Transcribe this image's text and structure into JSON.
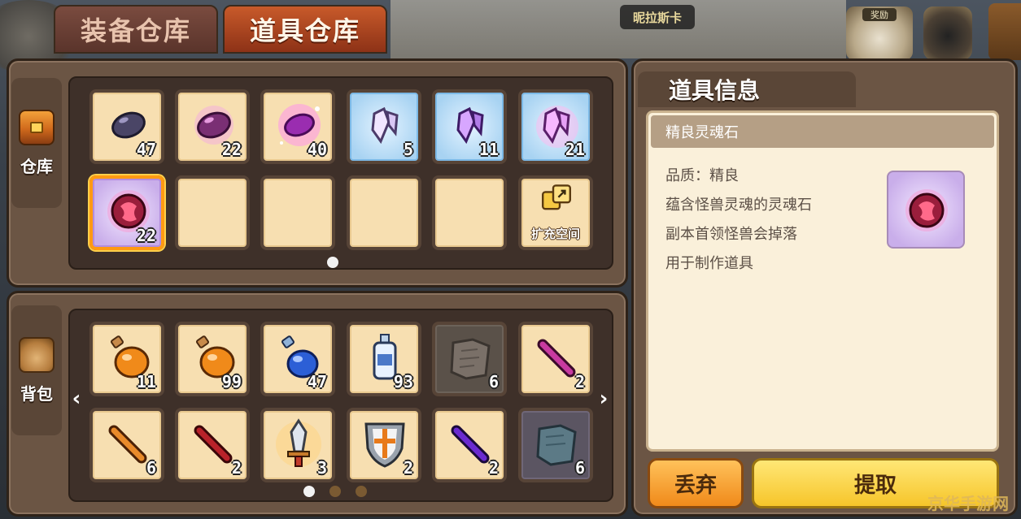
{
  "top": {
    "map_name": "昵拉斯卡",
    "icon1_tag": "奖励"
  },
  "tabs": [
    {
      "label": "装备仓库"
    },
    {
      "label": "道具仓库"
    }
  ],
  "storage": {
    "label": "仓库",
    "slots": [
      {
        "icon": "dark-stone-icon",
        "count": "47"
      },
      {
        "icon": "purple-stone-icon",
        "count": "22"
      },
      {
        "icon": "glowing-stone-icon",
        "count": "40"
      },
      {
        "icon": "crystal-icon",
        "count": "5"
      },
      {
        "icon": "purple-crystal-icon",
        "count": "11"
      },
      {
        "icon": "pink-crystal-icon",
        "count": "21"
      },
      {
        "icon": "soul-stone-icon",
        "count": "22"
      },
      {
        "icon": "empty",
        "count": ""
      },
      {
        "icon": "empty",
        "count": ""
      },
      {
        "icon": "empty",
        "count": ""
      },
      {
        "icon": "empty",
        "count": ""
      },
      {
        "icon": "expand-icon",
        "label": "扩充空间"
      }
    ]
  },
  "bag": {
    "label": "背包",
    "slots": [
      {
        "icon": "orange-potion-icon",
        "count": "11"
      },
      {
        "icon": "orange-potion-icon",
        "count": "99"
      },
      {
        "icon": "blue-potion-icon",
        "count": "47"
      },
      {
        "icon": "water-bottle-icon",
        "count": "93"
      },
      {
        "icon": "map-scroll-icon",
        "count": "6"
      },
      {
        "icon": "pink-vial-icon",
        "count": "2"
      },
      {
        "icon": "orange-vial-icon",
        "count": "6"
      },
      {
        "icon": "red-vial-icon",
        "count": "2"
      },
      {
        "icon": "sword-icon",
        "count": "3"
      },
      {
        "icon": "shield-icon",
        "count": "2"
      },
      {
        "icon": "purple-vial-icon",
        "count": "2"
      },
      {
        "icon": "scroll-icon",
        "count": "6"
      }
    ]
  },
  "info": {
    "title": "道具信息",
    "name": "精良灵魂石",
    "lines": [
      "品质：精良",
      "蕴含怪兽灵魂的灵魂石",
      "副本首领怪兽会掉落",
      "用于制作道具"
    ]
  },
  "buttons": {
    "discard": "丢弃",
    "extract": "提取"
  },
  "watermark": "京华手游网"
}
